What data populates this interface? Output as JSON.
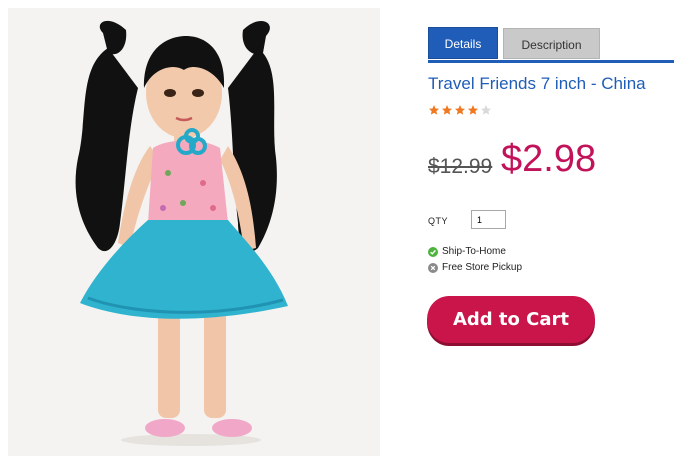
{
  "product": {
    "image_alt": "Travel Friends 7 inch doll"
  },
  "tabs": [
    {
      "label": "Details",
      "active": true
    },
    {
      "label": "Description",
      "active": false
    }
  ],
  "title": "Travel Friends 7 inch - China",
  "rating": {
    "value": 4,
    "max": 5,
    "star_color": "#f07820",
    "empty_color": "#d9d9d9"
  },
  "price": {
    "original": "$12.99",
    "sale": "$2.98"
  },
  "qty": {
    "label": "QTY",
    "value": "1"
  },
  "fulfillment": [
    {
      "label": "Ship-To-Home",
      "icon": "check-circle-icon",
      "available": true
    },
    {
      "label": "Free Store Pickup",
      "icon": "x-circle-icon",
      "available": false
    }
  ],
  "cart_button": {
    "label": "Add to Cart"
  },
  "colors": {
    "brand_blue": "#1f5db8",
    "sale_red": "#c2135a",
    "cart_button": "#c9154a",
    "available_green": "#4db33d",
    "unavailable_gray": "#8a8a8a"
  }
}
